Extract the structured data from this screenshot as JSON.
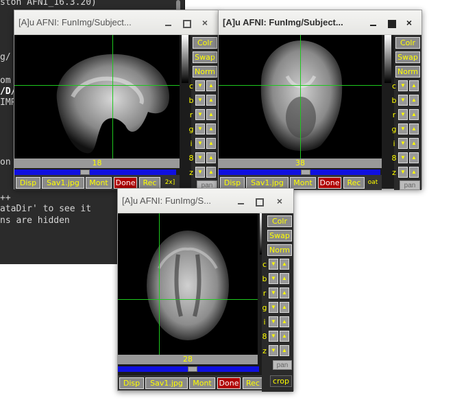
{
  "terminal": {
    "lines": [
      "ston AFNI_16.3.20)",
      "g/",
      "om",
      "/D/",
      "IMP",
      "on",
      "++",
      "ataDir' to see it",
      "ns are hidden"
    ]
  },
  "windows": {
    "sagittal": {
      "title": "[A]u AFNI: FunImg/Subject...",
      "slice": "18",
      "buttons": [
        "Disp",
        "Sav1.jpg",
        "Mont",
        "Done",
        "Rec"
      ],
      "side": {
        "colr": "Colr",
        "swap": "Swap",
        "norm": "Norm"
      },
      "labels": [
        "c",
        "b",
        "r",
        "g",
        "i",
        "8",
        "z"
      ],
      "extra": "pan",
      "extra2": "2x]"
    },
    "coronal": {
      "title": "[A]u AFNI: FunImg/Subject...",
      "slice": "38",
      "buttons": [
        "Disp",
        "Sav1.jpg",
        "Mont",
        "Done",
        "Rec"
      ],
      "side": {
        "colr": "Colr",
        "swap": "Swap",
        "norm": "Norm"
      },
      "labels": [
        "c",
        "b",
        "r",
        "g",
        "i",
        "8",
        "z"
      ],
      "extra": "pan",
      "extra2": "oat"
    },
    "axial": {
      "title": "[A]u AFNI: FunImg/S...",
      "slice": "28",
      "buttons": [
        "Disp",
        "Sav1.jpg",
        "Mont",
        "Done",
        "Rec"
      ],
      "side": {
        "colr": "Colr",
        "swap": "Swap",
        "norm": "Norm"
      },
      "labels": [
        "c",
        "b",
        "r",
        "g",
        "i",
        "8",
        "z"
      ],
      "extra": "pan",
      "crop": "crop"
    }
  },
  "icons": {
    "minimize": "minimize-icon",
    "maximize": "maximize-icon",
    "close": "×",
    "up_arrow": "▲",
    "down_arrow": "▼"
  },
  "colors": {
    "crosshair": "#1ec81e",
    "button_text": "#ffff00",
    "done_button": "#b00000",
    "slider": "#1010e0"
  }
}
